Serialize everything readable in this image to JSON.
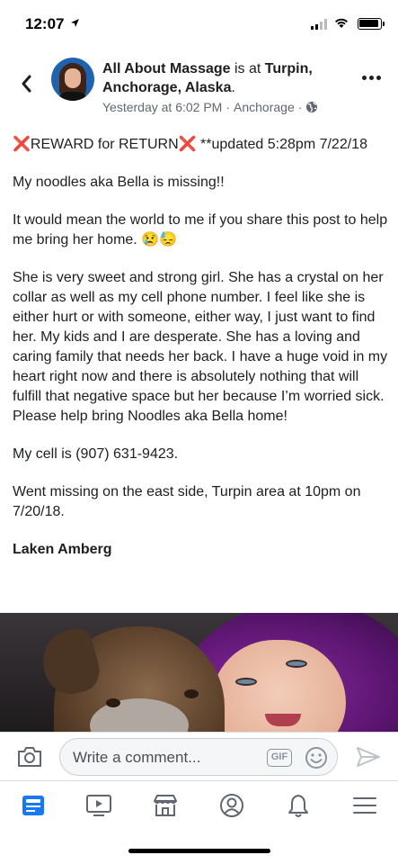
{
  "status_bar": {
    "time": "12:07"
  },
  "header": {
    "page_name": "All About Massage",
    "connector": " is at ",
    "location": "Turpin, Anchorage, Alaska",
    "trailing": ".",
    "timestamp": "Yesterday at 6:02 PM",
    "separator": " · ",
    "place": "Anchorage",
    "separator2": " · "
  },
  "post": {
    "reward_x": "❌",
    "reward_text": "REWARD for RETURN",
    "updated": " **updated 5:28pm 7/22/18",
    "p1": "My noodles aka Bella is missing!!",
    "p2": "It would mean the world to me if you share this post to help me bring her home.",
    "p2_emoji": "😢😓",
    "p3": "She is very sweet and strong girl. She has a crystal on her collar as well as my cell phone number. I feel like she is either hurt or with someone, either way, I just want to find her. My kids and I are desperate. She has a loving and caring family that needs her back. I have a huge void in my heart right now and there is absolutely nothing that will fulfill that negative space but her because I’m worried sick. Please help bring Noodles aka Bella home!",
    "p4": "My cell is (907) 631-9423.",
    "p5": "Went missing on the east side, Turpin area at 10pm on 7/20/18.",
    "signature": "Laken Amberg"
  },
  "comment": {
    "placeholder": "Write a comment...",
    "gif_label": "GIF"
  },
  "tabs": [
    "news-feed",
    "watch",
    "marketplace",
    "profile",
    "notifications",
    "menu"
  ],
  "colors": {
    "accent": "#1877f2",
    "icon_gray": "#606770"
  }
}
